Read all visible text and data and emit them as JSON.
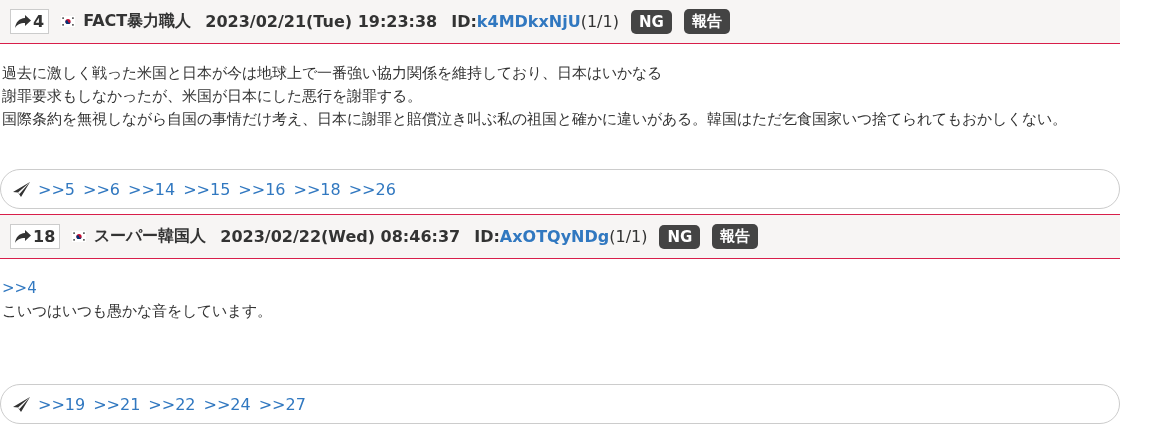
{
  "posts": [
    {
      "number": "4",
      "name": "FACT暴力職人",
      "date": "2023/02/21(Tue) 19:23:38",
      "id_label": "ID:",
      "id": "k4MDkxNjU",
      "id_count": "(1/1)",
      "buttons": [
        "NG",
        "報告"
      ],
      "body": [
        {
          "kind": "text",
          "text": "過去に激しく戦った米国と日本が今は地球上で一番強い協力関係を維持しており、日本はいかなる"
        },
        {
          "kind": "text",
          "text": "謝罪要求もしなかったが、米国が日本にした悪行を謝罪する。"
        },
        {
          "kind": "text",
          "text": "国際条約を無視しながら自国の事情だけ考え、日本に謝罪と賠償泣き叫ぶ私の祖国と確かに違いがある。韓国はただ乞食国家いつ捨てられてもおかしくない。"
        }
      ],
      "replies": [
        ">>5",
        ">>6",
        ">>14",
        ">>15",
        ">>16",
        ">>18",
        ">>26"
      ]
    },
    {
      "number": "18",
      "name": "スーパー韓国人",
      "date": "2023/02/22(Wed) 08:46:37",
      "id_label": "ID:",
      "id": "AxOTQyNDg",
      "id_count": "(1/1)",
      "buttons": [
        "NG",
        "報告"
      ],
      "body": [
        {
          "kind": "link",
          "text": ">>4"
        },
        {
          "kind": "text",
          "text": "こいつはいつも愚かな音をしています。"
        }
      ],
      "replies": [
        ">>19",
        ">>21",
        ">>22",
        ">>24",
        ">>27"
      ]
    }
  ]
}
